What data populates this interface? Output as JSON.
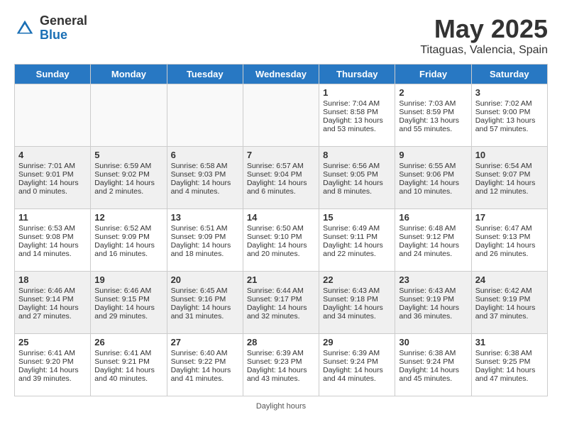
{
  "header": {
    "logo_general": "General",
    "logo_blue": "Blue",
    "month": "May 2025",
    "location": "Titaguas, Valencia, Spain"
  },
  "days_of_week": [
    "Sunday",
    "Monday",
    "Tuesday",
    "Wednesday",
    "Thursday",
    "Friday",
    "Saturday"
  ],
  "footer": "Daylight hours",
  "weeks": [
    [
      {
        "day": "",
        "info": ""
      },
      {
        "day": "",
        "info": ""
      },
      {
        "day": "",
        "info": ""
      },
      {
        "day": "",
        "info": ""
      },
      {
        "day": "1",
        "info": "Sunrise: 7:04 AM\nSunset: 8:58 PM\nDaylight: 13 hours\nand 53 minutes."
      },
      {
        "day": "2",
        "info": "Sunrise: 7:03 AM\nSunset: 8:59 PM\nDaylight: 13 hours\nand 55 minutes."
      },
      {
        "day": "3",
        "info": "Sunrise: 7:02 AM\nSunset: 9:00 PM\nDaylight: 13 hours\nand 57 minutes."
      }
    ],
    [
      {
        "day": "4",
        "info": "Sunrise: 7:01 AM\nSunset: 9:01 PM\nDaylight: 14 hours\nand 0 minutes."
      },
      {
        "day": "5",
        "info": "Sunrise: 6:59 AM\nSunset: 9:02 PM\nDaylight: 14 hours\nand 2 minutes."
      },
      {
        "day": "6",
        "info": "Sunrise: 6:58 AM\nSunset: 9:03 PM\nDaylight: 14 hours\nand 4 minutes."
      },
      {
        "day": "7",
        "info": "Sunrise: 6:57 AM\nSunset: 9:04 PM\nDaylight: 14 hours\nand 6 minutes."
      },
      {
        "day": "8",
        "info": "Sunrise: 6:56 AM\nSunset: 9:05 PM\nDaylight: 14 hours\nand 8 minutes."
      },
      {
        "day": "9",
        "info": "Sunrise: 6:55 AM\nSunset: 9:06 PM\nDaylight: 14 hours\nand 10 minutes."
      },
      {
        "day": "10",
        "info": "Sunrise: 6:54 AM\nSunset: 9:07 PM\nDaylight: 14 hours\nand 12 minutes."
      }
    ],
    [
      {
        "day": "11",
        "info": "Sunrise: 6:53 AM\nSunset: 9:08 PM\nDaylight: 14 hours\nand 14 minutes."
      },
      {
        "day": "12",
        "info": "Sunrise: 6:52 AM\nSunset: 9:09 PM\nDaylight: 14 hours\nand 16 minutes."
      },
      {
        "day": "13",
        "info": "Sunrise: 6:51 AM\nSunset: 9:09 PM\nDaylight: 14 hours\nand 18 minutes."
      },
      {
        "day": "14",
        "info": "Sunrise: 6:50 AM\nSunset: 9:10 PM\nDaylight: 14 hours\nand 20 minutes."
      },
      {
        "day": "15",
        "info": "Sunrise: 6:49 AM\nSunset: 9:11 PM\nDaylight: 14 hours\nand 22 minutes."
      },
      {
        "day": "16",
        "info": "Sunrise: 6:48 AM\nSunset: 9:12 PM\nDaylight: 14 hours\nand 24 minutes."
      },
      {
        "day": "17",
        "info": "Sunrise: 6:47 AM\nSunset: 9:13 PM\nDaylight: 14 hours\nand 26 minutes."
      }
    ],
    [
      {
        "day": "18",
        "info": "Sunrise: 6:46 AM\nSunset: 9:14 PM\nDaylight: 14 hours\nand 27 minutes."
      },
      {
        "day": "19",
        "info": "Sunrise: 6:46 AM\nSunset: 9:15 PM\nDaylight: 14 hours\nand 29 minutes."
      },
      {
        "day": "20",
        "info": "Sunrise: 6:45 AM\nSunset: 9:16 PM\nDaylight: 14 hours\nand 31 minutes."
      },
      {
        "day": "21",
        "info": "Sunrise: 6:44 AM\nSunset: 9:17 PM\nDaylight: 14 hours\nand 32 minutes."
      },
      {
        "day": "22",
        "info": "Sunrise: 6:43 AM\nSunset: 9:18 PM\nDaylight: 14 hours\nand 34 minutes."
      },
      {
        "day": "23",
        "info": "Sunrise: 6:43 AM\nSunset: 9:19 PM\nDaylight: 14 hours\nand 36 minutes."
      },
      {
        "day": "24",
        "info": "Sunrise: 6:42 AM\nSunset: 9:19 PM\nDaylight: 14 hours\nand 37 minutes."
      }
    ],
    [
      {
        "day": "25",
        "info": "Sunrise: 6:41 AM\nSunset: 9:20 PM\nDaylight: 14 hours\nand 39 minutes."
      },
      {
        "day": "26",
        "info": "Sunrise: 6:41 AM\nSunset: 9:21 PM\nDaylight: 14 hours\nand 40 minutes."
      },
      {
        "day": "27",
        "info": "Sunrise: 6:40 AM\nSunset: 9:22 PM\nDaylight: 14 hours\nand 41 minutes."
      },
      {
        "day": "28",
        "info": "Sunrise: 6:39 AM\nSunset: 9:23 PM\nDaylight: 14 hours\nand 43 minutes."
      },
      {
        "day": "29",
        "info": "Sunrise: 6:39 AM\nSunset: 9:24 PM\nDaylight: 14 hours\nand 44 minutes."
      },
      {
        "day": "30",
        "info": "Sunrise: 6:38 AM\nSunset: 9:24 PM\nDaylight: 14 hours\nand 45 minutes."
      },
      {
        "day": "31",
        "info": "Sunrise: 6:38 AM\nSunset: 9:25 PM\nDaylight: 14 hours\nand 47 minutes."
      }
    ]
  ]
}
